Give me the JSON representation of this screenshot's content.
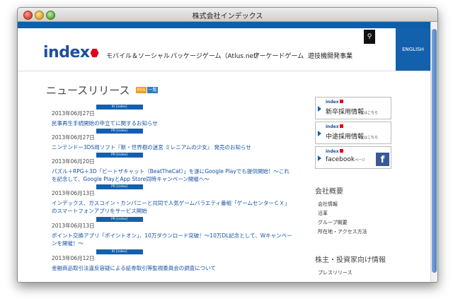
{
  "window": {
    "title": "株式会社インデックス"
  },
  "header": {
    "logo": "index",
    "nav": [
      "モバイル＆ソーシャル",
      "パッケージゲーム（Atlus.net）",
      "アーケードゲーム",
      "遊技機開発事業"
    ],
    "english": "ENGLISH"
  },
  "news": {
    "title": "ニュースリリース",
    "rss": "RSS",
    "ichiran": "一覧",
    "items": [
      {
        "date": "2013年06月27日",
        "tag": "IR [index]",
        "text": "民事再生手続開始の申立てに関するお知らせ"
      },
      {
        "date": "2013年06月27日",
        "tag": "PR [index]",
        "text": "ニンテンドー3DS用ソフト『新・世界樹の迷宮 ミレニアムの少女』 発売のお知らせ"
      },
      {
        "date": "2013年06月20日",
        "tag": "PR [index]",
        "text": "パズル＋RPG＋3D「ビートザキャット（BeatTheCat）」を遂にGoogle Playでも提供開始！～これを記念して、Google PlayとApp Store同時キャンペーン開催へ～"
      },
      {
        "date": "2013年06月13日",
        "tag": "PR [index]",
        "text": "インデックス、ガスコイン・カンパニーと共同で人気ゲームバラエティ番組「ゲームセンターＣＸ」のスマートフォンアプリをサービス開始"
      },
      {
        "date": "2013年06月13日",
        "tag": "PR [index]",
        "text": "ポイント交換アプリ「ポイントオン」、10万ダウンロード突破！～10万DL記念として、Wキャンペーンを開催！～"
      },
      {
        "date": "2013年06月12日",
        "tag": "IR [index]",
        "text": "金融商品取引法違反容疑による証券取引等監視委員会の調査について"
      }
    ]
  },
  "sidebar": {
    "banners": [
      {
        "logo": "index",
        "text": "新卒採用情報",
        "small": "はこちら"
      },
      {
        "logo": "index",
        "text": "中途採用情報",
        "small": "はこちら"
      },
      {
        "logo": "index",
        "text": "facebook",
        "small": "ページ"
      }
    ],
    "company_heading": "会社概要",
    "company_links": [
      "会社情報",
      "沿革",
      "グループ概要",
      "所在地・アクセス方法"
    ],
    "ir_heading": "株主・投資家向け情報",
    "ir_links": [
      "プレスリリース"
    ]
  },
  "colors": {
    "brand_blue": "#0f5fa8",
    "brand_red": "#e2001a",
    "link": "#1550a0"
  }
}
